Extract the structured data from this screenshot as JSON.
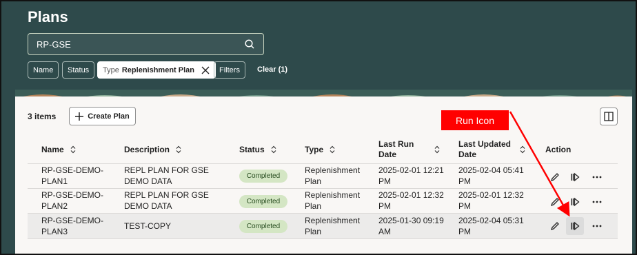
{
  "page": {
    "title": "Plans"
  },
  "search": {
    "value": "RP-GSE"
  },
  "filters": {
    "name_label": "Name",
    "status_label": "Status",
    "type_key": "Type",
    "type_value": "Replenishment Plan",
    "filters_label": "Filters",
    "clear_label": "Clear (1)"
  },
  "toolbar": {
    "count": "3 items",
    "create_label": "Create Plan"
  },
  "table": {
    "headers": {
      "name": "Name",
      "description": "Description",
      "status": "Status",
      "type": "Type",
      "last_run": "Last Run Date",
      "last_updated": "Last Updated Date",
      "action": "Action"
    },
    "rows": [
      {
        "name": "RP-GSE-DEMO-PLAN1",
        "description": "REPL PLAN FOR GSE DEMO DATA",
        "status": "Completed",
        "type": "Replenishment Plan",
        "last_run": "2025-02-01 12:21 PM",
        "last_updated": "2025-02-04 05:41 PM"
      },
      {
        "name": "RP-GSE-DEMO-PLAN2",
        "description": "REPL PLAN FOR GSE DEMO DATA",
        "status": "Completed",
        "type": "Replenishment Plan",
        "last_run": "2025-02-01 12:32 PM",
        "last_updated": "2025-02-01 12:32 PM"
      },
      {
        "name": "RP-GSE-DEMO-PLAN3",
        "description": "TEST-COPY",
        "status": "Completed",
        "type": "Replenishment Plan",
        "last_run": "2025-01-30 09:19 AM",
        "last_updated": "2025-02-04 05:31 PM"
      }
    ]
  },
  "annotation": {
    "label": "Run Icon"
  },
  "colors": {
    "header_bg": "#2e4a4b",
    "badge_bg": "#d4e6c4",
    "callout": "#ff0000"
  },
  "icons": [
    "search-icon",
    "close-icon",
    "plus-icon",
    "panel-icon",
    "sort-icon",
    "pencil-icon",
    "run-icon",
    "more-icon"
  ]
}
